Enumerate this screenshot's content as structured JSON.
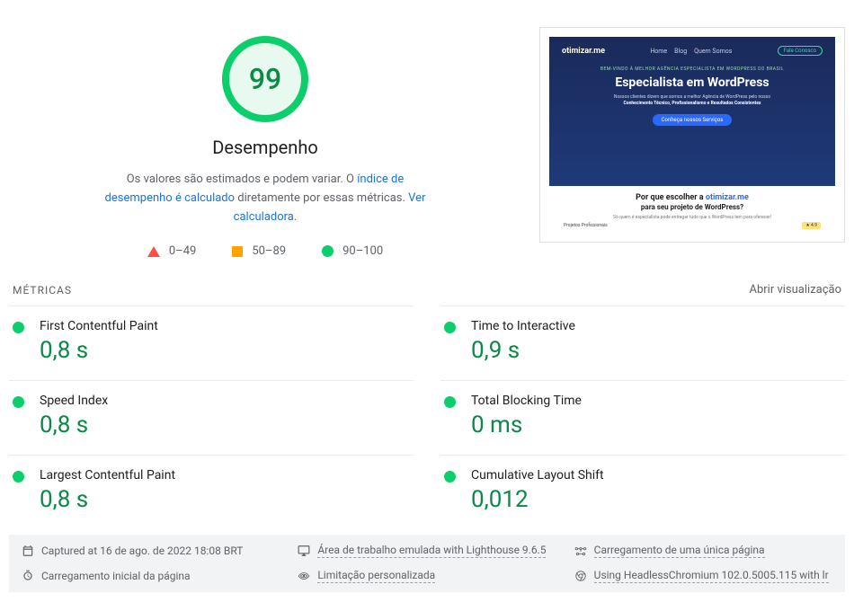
{
  "gauge": {
    "score": "99",
    "title": "Desempenho",
    "desc_prefix": "Os valores são estimados e podem variar. O ",
    "desc_link1": "índice de desempenho é calculado",
    "desc_mid": " diretamente por essas métricas. ",
    "desc_link2": "Ver calculadora",
    "desc_suffix": "."
  },
  "legend": {
    "range_bad": "0–49",
    "range_avg": "50–89",
    "range_good": "90–100"
  },
  "thumbnail": {
    "brand": "otimizar.me",
    "nav1": "Home",
    "nav2": "Blog",
    "nav3": "Quem Somos",
    "cta_top": "Fale Conosco",
    "kicker": "BEM-VINDO À MELHOR AGÊNCIA ESPECIALISTA EM WORDPRESS DO BRASIL",
    "headline": "Especialista em WordPress",
    "sub_prefix": "Nossos clientes dizem que somos a melhor Agência de WordPress pelo nosso ",
    "sub_bold": "Conhecimento Técnico, Profissionalismo e Resultados Consistentes",
    "btn": "Conheça nossos Serviços",
    "lower_q_prefix": "Por que escolher a ",
    "lower_q_accent": "otimizar.me",
    "lower_q2": "para seu projeto de WordPress?",
    "lower_p": "Só quem é especialista pode entregar tudo que o WordPress tem para oferecer!",
    "lower_left": "Projetos Profissionais",
    "lower_badge": "4.9"
  },
  "metrics_header": {
    "title": "MÉTRICAS",
    "view": "Abrir visualização"
  },
  "metrics": {
    "fcp": {
      "name": "First Contentful Paint",
      "val": "0,8 s"
    },
    "tti": {
      "name": "Time to Interactive",
      "val": "0,9 s"
    },
    "si": {
      "name": "Speed Index",
      "val": "0,8 s"
    },
    "tbt": {
      "name": "Total Blocking Time",
      "val": "0 ms"
    },
    "lcp": {
      "name": "Largest Contentful Paint",
      "val": "0,8 s"
    },
    "cls": {
      "name": "Cumulative Layout Shift",
      "val": "0,012"
    }
  },
  "footer": {
    "captured": "Captured at 16 de ago. de 2022 18:08 BRT",
    "device": "Área de trabalho emulada with Lighthouse 9.6.5",
    "loadtype": "Carregamento de uma única página",
    "initial": "Carregamento inicial da página",
    "throttle": "Limitação personalizada",
    "browser": "Using HeadlessChromium 102.0.5005.115 with lr"
  }
}
